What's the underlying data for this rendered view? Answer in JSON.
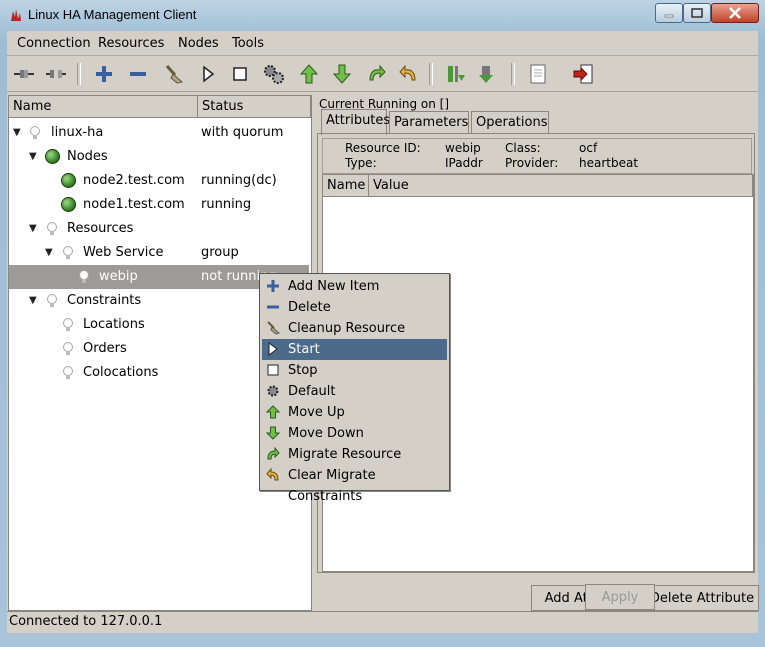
{
  "window": {
    "title": "Linux HA Management Client"
  },
  "menubar": [
    "Connection",
    "Resources",
    "Nodes",
    "Tools"
  ],
  "toolbar": {
    "icons": [
      "connect-icon",
      "disconnect-icon",
      "add-icon",
      "remove-icon",
      "cleanup-icon",
      "start-icon",
      "stop-icon",
      "default-icon",
      "move-up-icon",
      "move-down-icon",
      "migrate-icon",
      "clear-migrate-icon",
      "standby-icon",
      "active-icon",
      "view-log-icon",
      "exit-icon"
    ]
  },
  "tree": {
    "columns": [
      "Name",
      "Status"
    ],
    "rows": [
      {
        "name": "linux-ha",
        "status": "with quorum"
      },
      {
        "name": "Nodes",
        "status": ""
      },
      {
        "name": "node2.test.com",
        "status": "running(dc)"
      },
      {
        "name": "node1.test.com",
        "status": "running"
      },
      {
        "name": "Resources",
        "status": ""
      },
      {
        "name": "Web Service",
        "status": "group"
      },
      {
        "name": "webip",
        "status": "not running"
      },
      {
        "name": "Constraints",
        "status": ""
      },
      {
        "name": "Locations",
        "status": ""
      },
      {
        "name": "Orders",
        "status": ""
      },
      {
        "name": "Colocations",
        "status": ""
      }
    ]
  },
  "right": {
    "current_label": "Current Running on []",
    "tabs": [
      "Attributes",
      "Parameters",
      "Operations"
    ],
    "info": {
      "resource_id_label": "Resource ID:",
      "resource_id": "webip",
      "type_label": "Type:",
      "type": "IPaddr",
      "class_label": "Class:",
      "class": "ocf",
      "provider_label": "Provider:",
      "provider": "heartbeat"
    },
    "table_columns": [
      "Name",
      "Value"
    ],
    "add_attribute": "Add Attribute",
    "delete_attribute": "Delete Attribute",
    "apply": "Apply"
  },
  "context_menu": {
    "items": [
      {
        "label": "Add New Item",
        "icon": "plus-icon"
      },
      {
        "label": "Delete",
        "icon": "minus-icon"
      },
      {
        "label": "Cleanup Resource",
        "icon": "broom-icon"
      },
      {
        "label": "Start",
        "icon": "play-icon"
      },
      {
        "label": "Stop",
        "icon": "stop-icon"
      },
      {
        "label": "Default",
        "icon": "gear-icon"
      },
      {
        "label": "Move Up",
        "icon": "arrow-up-icon"
      },
      {
        "label": "Move Down",
        "icon": "arrow-down-icon"
      },
      {
        "label": "Migrate Resource",
        "icon": "migrate-icon"
      },
      {
        "label": "Clear Migrate Constraints",
        "icon": "undo-icon"
      }
    ],
    "highlighted": "Start"
  },
  "statusbar": "Connected to 127.0.0.1"
}
